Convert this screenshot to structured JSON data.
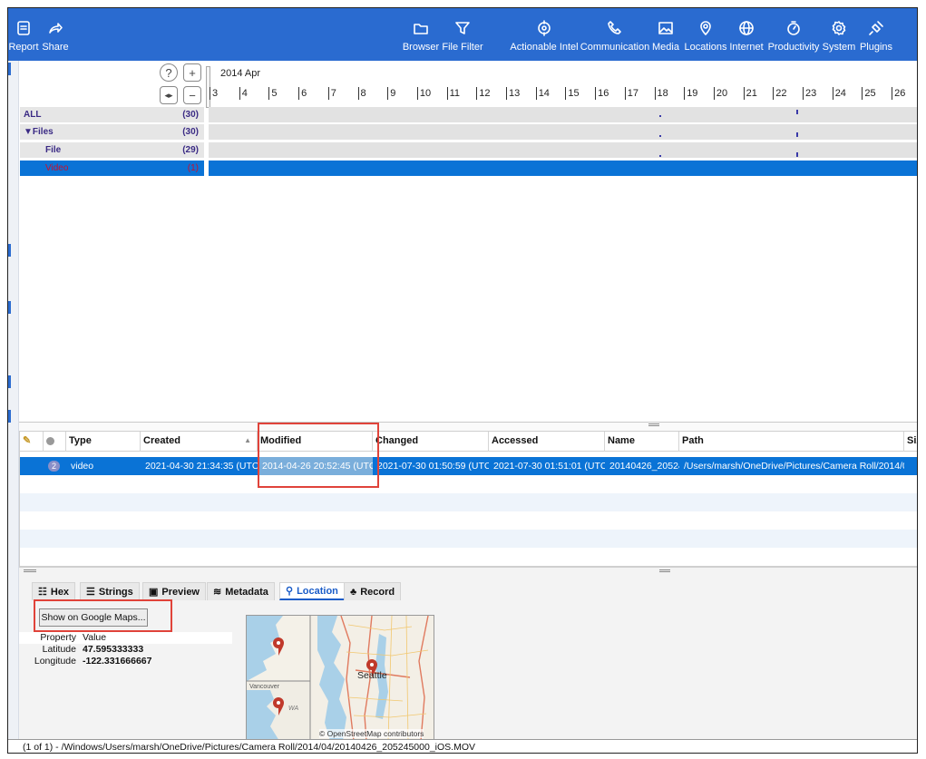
{
  "toolbar": {
    "left": [
      {
        "label": "Report",
        "icon": "report-icon"
      },
      {
        "label": "Share",
        "icon": "share-icon"
      }
    ],
    "right": [
      {
        "label": "Browser",
        "icon": "folder-icon"
      },
      {
        "label": "File Filter",
        "icon": "filter-icon"
      },
      {
        "label": "Actionable Intel",
        "icon": "intel-icon"
      },
      {
        "label": "Communication",
        "icon": "phone-icon"
      },
      {
        "label": "Media",
        "icon": "image-icon"
      },
      {
        "label": "Locations",
        "icon": "map-pin-icon"
      },
      {
        "label": "Internet",
        "icon": "globe-icon"
      },
      {
        "label": "Productivity",
        "icon": "timer-icon"
      },
      {
        "label": "System",
        "icon": "gear-icon"
      },
      {
        "label": "Plugins",
        "icon": "plug-icon"
      }
    ]
  },
  "timeline": {
    "month": "2014 Apr",
    "days": [
      "3",
      "4",
      "5",
      "6",
      "7",
      "8",
      "9",
      "10",
      "11",
      "12",
      "13",
      "14",
      "15",
      "16",
      "17",
      "18",
      "19",
      "20",
      "21",
      "22",
      "23",
      "24",
      "25",
      "26"
    ],
    "rows": [
      {
        "label": "ALL",
        "count": "(30)"
      },
      {
        "label": "▼Files",
        "count": "(30)"
      },
      {
        "label": "File",
        "count": "(29)"
      },
      {
        "label": "Video",
        "count": "(1)"
      }
    ],
    "selected_color": "#0a73d6"
  },
  "table": {
    "headers": [
      "Type",
      "Created",
      "Modified",
      "Changed",
      "Accessed",
      "Name",
      "Path",
      "Siz"
    ],
    "rows": [
      {
        "badge": "2",
        "type": "video",
        "created": "2021-04-30 21:34:35 (UTC)",
        "modified": "2014-04-26 20:52:45 (UTC)",
        "changed": "2021-07-30 01:50:59 (UTC)",
        "accessed": "2021-07-30 01:51:01 (UTC)",
        "name": "20140426_20524...",
        "path": "/Users/marsh/OneDrive/Pictures/Camera Roll/2014/0..."
      }
    ]
  },
  "tabs": [
    {
      "label": "Hex",
      "icon": "hex-icon"
    },
    {
      "label": "Strings",
      "icon": "strings-icon"
    },
    {
      "label": "Preview",
      "icon": "preview-icon"
    },
    {
      "label": "Metadata",
      "icon": "layers-icon"
    },
    {
      "label": "Location",
      "icon": "location-pin-icon",
      "active": true
    },
    {
      "label": "Record",
      "icon": "record-icon"
    }
  ],
  "location": {
    "button": "Show on Google Maps...",
    "header": {
      "property": "Property",
      "value": "Value"
    },
    "latitude_label": "Latitude",
    "latitude": "47.595333333",
    "longitude_label": "Longitude",
    "longitude": "-122.331666667",
    "map_city": "Seattle",
    "map_vancouver": "Vancouver",
    "map_wa": "WA",
    "map_credit": "© OpenStreetMap contributors"
  },
  "status": "(1 of 1)  -  /Windows/Users/marsh/OneDrive/Pictures/Camera Roll/2014/04/20140426_205245000_iOS.MOV",
  "accent": "#2a6bd0",
  "highlight": "#e0433a"
}
